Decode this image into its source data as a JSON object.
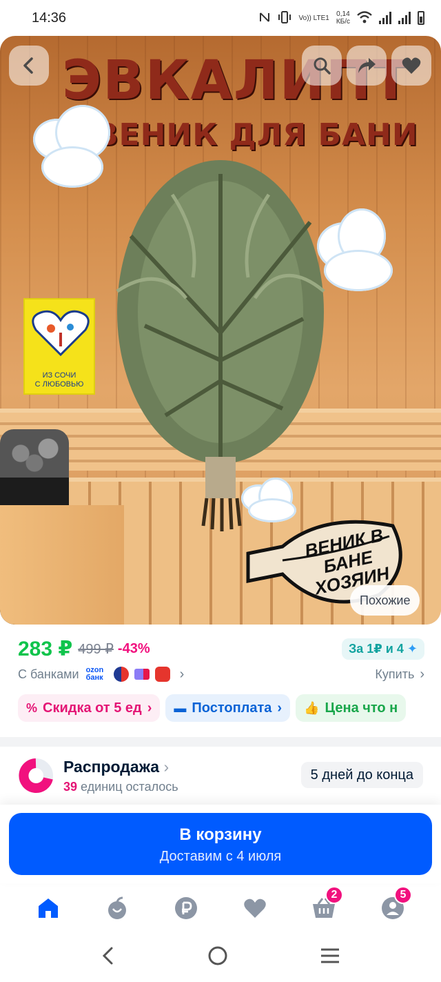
{
  "status_bar": {
    "time": "14:36",
    "network_speed": "0,14",
    "network_unit": "КБ/с",
    "volte": "Vo)) LTE1",
    "icons": [
      "nfc-icon",
      "vibrate-icon",
      "volte-icon",
      "wifi-icon",
      "signal-icon",
      "signal-icon",
      "battery-icon"
    ]
  },
  "product_image": {
    "title": "ЭВКАЛИПТ",
    "subtitle": "ВЕНИК ДЛЯ БАНИ",
    "badge_left_line1": "ИЗ СОЧИ",
    "badge_left_line2": "С ЛЮБОВЬЮ",
    "badge_right": "ВЕНИК В БАНЕ ХОЗЯИН",
    "similar_label": "Похожие"
  },
  "top_actions": [
    "back-icon",
    "search-icon",
    "share-icon",
    "heart-icon"
  ],
  "price": {
    "current": "283 ₽",
    "old": "499 ₽",
    "discount": "-43%",
    "points": "За 1₽ и 4",
    "with_banks": "С банками",
    "ozon_bank_line1": "ozon",
    "ozon_bank_line2": "банк",
    "buy_link": "Купить"
  },
  "chips": [
    {
      "label": "Скидка от 5 ед",
      "icon": "percent-icon",
      "style": "pink"
    },
    {
      "label": "Постоплата",
      "icon": "wallet-icon",
      "style": "blue"
    },
    {
      "label": "Цена что н",
      "icon": "thumbs-up-icon",
      "style": "green"
    }
  ],
  "sale": {
    "title": "Распродажа",
    "units_count": "39",
    "units_text": " единиц осталось",
    "timer": "5 дней до конца"
  },
  "cart_button": {
    "label": "В корзину",
    "sublabel": "Доставим с 4 июля"
  },
  "tabbar": {
    "items": [
      "home-icon",
      "fresh-icon",
      "ruble-icon",
      "favorites-icon",
      "cart-icon",
      "profile-icon"
    ],
    "cart_badge": "2",
    "profile_badge": "5"
  },
  "colors": {
    "accent": "#005bff",
    "price_green": "#10c44c",
    "discount_pink": "#f1117e"
  }
}
